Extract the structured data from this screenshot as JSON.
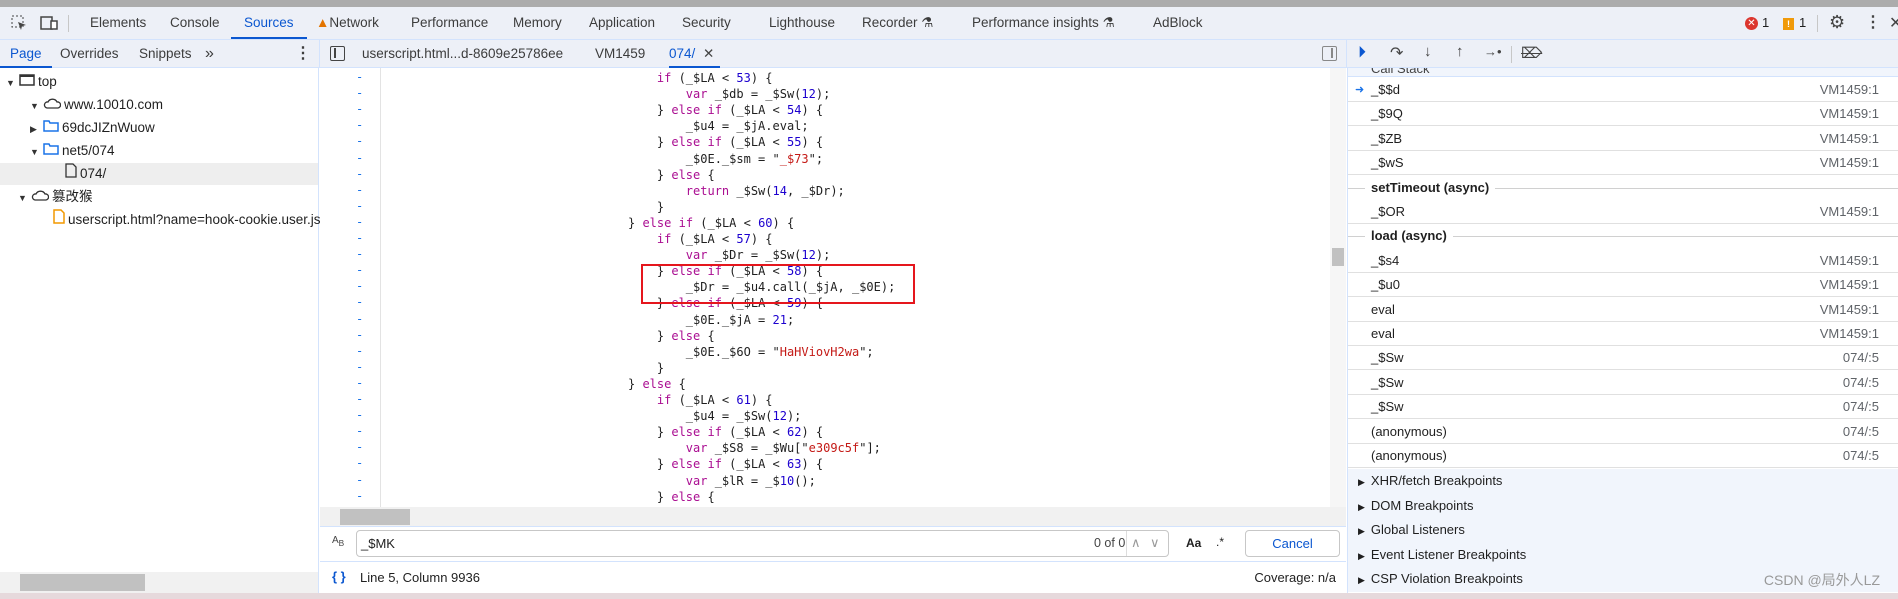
{
  "main_tabs": [
    {
      "label": "Elements"
    },
    {
      "label": "Console"
    },
    {
      "label": "Sources",
      "active": true
    },
    {
      "label": "Network",
      "warning": true
    },
    {
      "label": "Performance"
    },
    {
      "label": "Memory"
    },
    {
      "label": "Application"
    },
    {
      "label": "Security"
    },
    {
      "label": "Lighthouse"
    },
    {
      "label": "Recorder",
      "experimental": true
    },
    {
      "label": "Performance insights",
      "experimental": true
    },
    {
      "label": "AdBlock"
    }
  ],
  "status_badges": {
    "errors": "1",
    "warnings": "1"
  },
  "navigator_tabs": [
    {
      "label": "Page",
      "active": true
    },
    {
      "label": "Overrides"
    },
    {
      "label": "Snippets"
    }
  ],
  "more_tabs": "»",
  "file_tree": [
    {
      "label": "top",
      "icon": "frame-icon"
    },
    {
      "label": "www.10010.com",
      "icon": "cloud-icon"
    },
    {
      "label": "69dcJIZnWuow",
      "icon": "folder-icon"
    },
    {
      "label": "net5/074",
      "icon": "folder-icon"
    },
    {
      "label": "074/",
      "icon": "file-icon",
      "selected": true
    },
    {
      "label": "篡改猴",
      "icon": "cloud-icon"
    },
    {
      "label": "userscript.html?name=hook-cookie.user.js",
      "icon": "script-file-icon"
    }
  ],
  "editor_tabs": [
    {
      "label": "userscript.html...d-8609e25786ee"
    },
    {
      "label": "VM1459"
    },
    {
      "label": "074/",
      "active": true,
      "closable": true
    }
  ],
  "gutter_marker": "-",
  "code_lines": [
    "    if (_$LA < 53) {",
    "        var _$db = _$Sw(12);",
    "    } else if (_$LA < 54) {",
    "        _$u4 = _$jA.eval;",
    "    } else if (_$LA < 55) {",
    "        _$0E._$sm = \"_$73\";",
    "    } else {",
    "        return _$Sw(14, _$Dr);",
    "    }",
    "} else if (_$LA < 60) {",
    "    if (_$LA < 57) {",
    "        var _$Dr = _$Sw(12);",
    "    } else if (_$LA < 58) {",
    "        _$Dr = _$u4.call(_$jA, _$0E);",
    "    } else if (_$LA < 59) {",
    "        _$0E._$jA = 21;",
    "    } else {",
    "        _$0E._$6O = \"HaHViovH2wa\";",
    "    }",
    "} else {",
    "    if (_$LA < 61) {",
    "        _$u4 = _$Sw(12);",
    "    } else if (_$LA < 62) {",
    "        var _$S8 = _$Wu[\"e309c5f\"];",
    "    } else if (_$LA < 63) {",
    "        var _$lR = _$10();",
    "    } else {"
  ],
  "search": {
    "value": "_$MK",
    "match_count": "0 of 0",
    "match_case": "Aa",
    "regex": ".*",
    "cancel": "Cancel"
  },
  "status_bar": {
    "position": "Line 5, Column 9936",
    "coverage": "Coverage: n/a"
  },
  "call_stack_header": "Call Stack",
  "call_stack": [
    {
      "name": "_$$d",
      "location": "VM1459:1",
      "current": true
    },
    {
      "name": "_$9Q",
      "location": "VM1459:1"
    },
    {
      "name": "_$ZB",
      "location": "VM1459:1"
    },
    {
      "name": "_$wS",
      "location": "VM1459:1"
    },
    {
      "name": "setTimeout (async)",
      "async": true
    },
    {
      "name": "_$OR",
      "location": "VM1459:1"
    },
    {
      "name": "load (async)",
      "async": true
    },
    {
      "name": "_$s4",
      "location": "VM1459:1"
    },
    {
      "name": "_$u0",
      "location": "VM1459:1"
    },
    {
      "name": "eval",
      "location": "VM1459:1"
    },
    {
      "name": "eval",
      "location": "VM1459:1"
    },
    {
      "name": "_$Sw",
      "location": "074/:5"
    },
    {
      "name": "_$Sw",
      "location": "074/:5"
    },
    {
      "name": "_$Sw",
      "location": "074/:5"
    },
    {
      "name": "(anonymous)",
      "location": "074/:5"
    },
    {
      "name": "(anonymous)",
      "location": "074/:5"
    }
  ],
  "breakpoint_sections": [
    "XHR/fetch Breakpoints",
    "DOM Breakpoints",
    "Global Listeners",
    "Event Listener Breakpoints",
    "CSP Violation Breakpoints"
  ],
  "watermark": "CSDN @局外人LZ",
  "colors": {
    "accent": "#0b57d0",
    "highlight_box": "#e5161d",
    "keyword": "#aa0d91",
    "number": "#1c00cf",
    "string": "#c41a16"
  }
}
